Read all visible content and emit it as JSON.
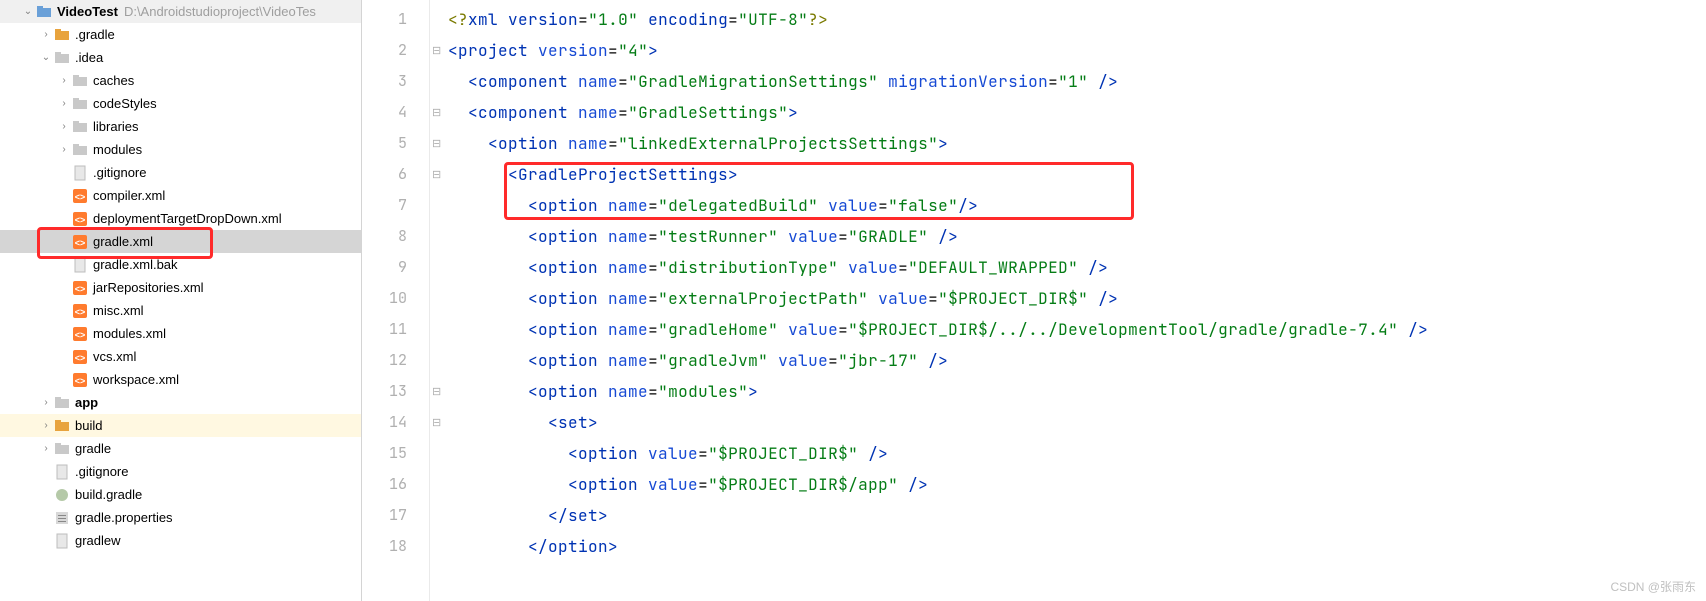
{
  "tree": {
    "root": "VideoTest",
    "root_path": "D:\\Androidstudioproject\\VideoTes",
    "items": [
      {
        "indent": 1,
        "chev": "down",
        "kind": "project",
        "name": "VideoTest",
        "path": "D:\\Androidstudioproject\\VideoTes"
      },
      {
        "indent": 2,
        "chev": "right",
        "kind": "folder-orange",
        "name": ".gradle"
      },
      {
        "indent": 2,
        "chev": "down",
        "kind": "folder-normal",
        "name": ".idea"
      },
      {
        "indent": 3,
        "chev": "right",
        "kind": "folder-leaf",
        "name": "caches"
      },
      {
        "indent": 3,
        "chev": "right",
        "kind": "folder-leaf",
        "name": "codeStyles"
      },
      {
        "indent": 3,
        "chev": "right",
        "kind": "folder-leaf",
        "name": "libraries"
      },
      {
        "indent": 3,
        "chev": "right",
        "kind": "folder-leaf",
        "name": "modules"
      },
      {
        "indent": 3,
        "chev": "none",
        "kind": "file-generic",
        "name": ".gitignore"
      },
      {
        "indent": 3,
        "chev": "none",
        "kind": "file-xml",
        "name": "compiler.xml"
      },
      {
        "indent": 3,
        "chev": "none",
        "kind": "file-xml",
        "name": "deploymentTargetDropDown.xml"
      },
      {
        "indent": 3,
        "chev": "none",
        "kind": "file-xml",
        "name": "gradle.xml",
        "selected": true
      },
      {
        "indent": 3,
        "chev": "none",
        "kind": "file-generic",
        "name": "gradle.xml.bak"
      },
      {
        "indent": 3,
        "chev": "none",
        "kind": "file-xml",
        "name": "jarRepositories.xml"
      },
      {
        "indent": 3,
        "chev": "none",
        "kind": "file-xml",
        "name": "misc.xml"
      },
      {
        "indent": 3,
        "chev": "none",
        "kind": "file-xml",
        "name": "modules.xml"
      },
      {
        "indent": 3,
        "chev": "none",
        "kind": "file-xml",
        "name": "vcs.xml"
      },
      {
        "indent": 3,
        "chev": "none",
        "kind": "file-xml",
        "name": "workspace.xml"
      },
      {
        "indent": 2,
        "chev": "right",
        "kind": "folder-normal",
        "name": "app",
        "bold": true
      },
      {
        "indent": 2,
        "chev": "right",
        "kind": "folder-orange",
        "name": "build",
        "highlight": true
      },
      {
        "indent": 2,
        "chev": "right",
        "kind": "folder-normal",
        "name": "gradle"
      },
      {
        "indent": 2,
        "chev": "none",
        "kind": "file-generic",
        "name": ".gitignore"
      },
      {
        "indent": 2,
        "chev": "none",
        "kind": "file-gradle",
        "name": "build.gradle"
      },
      {
        "indent": 2,
        "chev": "none",
        "kind": "file-properties",
        "name": "gradle.properties"
      },
      {
        "indent": 2,
        "chev": "none",
        "kind": "file-generic",
        "name": "gradlew"
      }
    ]
  },
  "editor": {
    "lines": [
      {
        "n": 1,
        "fold": "",
        "segs": [
          [
            "<?",
            "pi"
          ],
          [
            "xml",
            "pik"
          ],
          [
            " ",
            "punc"
          ],
          [
            "version",
            "pik"
          ],
          [
            "=",
            "punc"
          ],
          [
            "\"1.0\"",
            "pistr"
          ],
          [
            " ",
            "punc"
          ],
          [
            "encoding",
            "pik"
          ],
          [
            "=",
            "punc"
          ],
          [
            "\"UTF-8\"",
            "pistr"
          ],
          [
            "?>",
            "pi"
          ]
        ]
      },
      {
        "n": 2,
        "fold": "-",
        "segs": [
          [
            "<",
            "tag"
          ],
          [
            "project ",
            "tag"
          ],
          [
            "version",
            "attr"
          ],
          [
            "=",
            "punc"
          ],
          [
            "\"4\"",
            "str"
          ],
          [
            ">",
            "tag"
          ]
        ]
      },
      {
        "n": 3,
        "fold": "",
        "segs": [
          [
            "  ",
            "punc"
          ],
          [
            "<",
            "tag"
          ],
          [
            "component ",
            "tag"
          ],
          [
            "name",
            "attr"
          ],
          [
            "=",
            "punc"
          ],
          [
            "\"GradleMigrationSettings\"",
            "str"
          ],
          [
            " ",
            "punc"
          ],
          [
            "migrationVersion",
            "attr"
          ],
          [
            "=",
            "punc"
          ],
          [
            "\"1\"",
            "str"
          ],
          [
            " />",
            "tag"
          ]
        ]
      },
      {
        "n": 4,
        "fold": "-",
        "segs": [
          [
            "  ",
            "punc"
          ],
          [
            "<",
            "tag"
          ],
          [
            "component ",
            "tag"
          ],
          [
            "name",
            "attr"
          ],
          [
            "=",
            "punc"
          ],
          [
            "\"GradleSettings\"",
            "str"
          ],
          [
            ">",
            "tag"
          ]
        ]
      },
      {
        "n": 5,
        "fold": "-",
        "segs": [
          [
            "    ",
            "punc"
          ],
          [
            "<",
            "tag"
          ],
          [
            "option ",
            "tag"
          ],
          [
            "name",
            "attr"
          ],
          [
            "=",
            "punc"
          ],
          [
            "\"linkedExternalProjectsSettings\"",
            "str"
          ],
          [
            ">",
            "tag"
          ]
        ]
      },
      {
        "n": 6,
        "fold": "-",
        "segs": [
          [
            "      ",
            "punc"
          ],
          [
            "<",
            "tag"
          ],
          [
            "GradleProjectSettings",
            "tag"
          ],
          [
            ">",
            "tag"
          ]
        ]
      },
      {
        "n": 7,
        "fold": "",
        "segs": [
          [
            "        ",
            "punc"
          ],
          [
            "<",
            "tag"
          ],
          [
            "option ",
            "tag"
          ],
          [
            "name",
            "attr"
          ],
          [
            "=",
            "punc"
          ],
          [
            "\"delegatedBuild\"",
            "str"
          ],
          [
            " ",
            "punc"
          ],
          [
            "value",
            "attr"
          ],
          [
            "=",
            "punc"
          ],
          [
            "\"false\"",
            "str"
          ],
          [
            "/>",
            "tag"
          ]
        ]
      },
      {
        "n": 8,
        "fold": "",
        "segs": [
          [
            "        ",
            "punc"
          ],
          [
            "<",
            "tag"
          ],
          [
            "option ",
            "tag"
          ],
          [
            "name",
            "attr"
          ],
          [
            "=",
            "punc"
          ],
          [
            "\"testRunner\"",
            "str"
          ],
          [
            " ",
            "punc"
          ],
          [
            "value",
            "attr"
          ],
          [
            "=",
            "punc"
          ],
          [
            "\"GRADLE\"",
            "str"
          ],
          [
            " />",
            "tag"
          ]
        ]
      },
      {
        "n": 9,
        "fold": "",
        "segs": [
          [
            "        ",
            "punc"
          ],
          [
            "<",
            "tag"
          ],
          [
            "option ",
            "tag"
          ],
          [
            "name",
            "attr"
          ],
          [
            "=",
            "punc"
          ],
          [
            "\"distributionType\"",
            "str"
          ],
          [
            " ",
            "punc"
          ],
          [
            "value",
            "attr"
          ],
          [
            "=",
            "punc"
          ],
          [
            "\"DEFAULT_WRAPPED\"",
            "str"
          ],
          [
            " />",
            "tag"
          ]
        ]
      },
      {
        "n": 10,
        "fold": "",
        "segs": [
          [
            "        ",
            "punc"
          ],
          [
            "<",
            "tag"
          ],
          [
            "option ",
            "tag"
          ],
          [
            "name",
            "attr"
          ],
          [
            "=",
            "punc"
          ],
          [
            "\"externalProjectPath\"",
            "str"
          ],
          [
            " ",
            "punc"
          ],
          [
            "value",
            "attr"
          ],
          [
            "=",
            "punc"
          ],
          [
            "\"$PROJECT_DIR$\"",
            "str"
          ],
          [
            " />",
            "tag"
          ]
        ]
      },
      {
        "n": 11,
        "fold": "",
        "segs": [
          [
            "        ",
            "punc"
          ],
          [
            "<",
            "tag"
          ],
          [
            "option ",
            "tag"
          ],
          [
            "name",
            "attr"
          ],
          [
            "=",
            "punc"
          ],
          [
            "\"gradleHome\"",
            "str"
          ],
          [
            " ",
            "punc"
          ],
          [
            "value",
            "attr"
          ],
          [
            "=",
            "punc"
          ],
          [
            "\"$PROJECT_DIR$/../../DevelopmentTool/gradle/gradle-7.4\"",
            "str"
          ],
          [
            " />",
            "tag"
          ]
        ]
      },
      {
        "n": 12,
        "fold": "",
        "segs": [
          [
            "        ",
            "punc"
          ],
          [
            "<",
            "tag"
          ],
          [
            "option ",
            "tag"
          ],
          [
            "name",
            "attr"
          ],
          [
            "=",
            "punc"
          ],
          [
            "\"gradleJvm\"",
            "str"
          ],
          [
            " ",
            "punc"
          ],
          [
            "value",
            "attr"
          ],
          [
            "=",
            "punc"
          ],
          [
            "\"jbr-17\"",
            "str"
          ],
          [
            " />",
            "tag"
          ]
        ]
      },
      {
        "n": 13,
        "fold": "-",
        "segs": [
          [
            "        ",
            "punc"
          ],
          [
            "<",
            "tag"
          ],
          [
            "option ",
            "tag"
          ],
          [
            "name",
            "attr"
          ],
          [
            "=",
            "punc"
          ],
          [
            "\"modules\"",
            "str"
          ],
          [
            ">",
            "tag"
          ]
        ]
      },
      {
        "n": 14,
        "fold": "-",
        "segs": [
          [
            "          ",
            "punc"
          ],
          [
            "<",
            "tag"
          ],
          [
            "set",
            "tag"
          ],
          [
            ">",
            "tag"
          ]
        ]
      },
      {
        "n": 15,
        "fold": "",
        "segs": [
          [
            "            ",
            "punc"
          ],
          [
            "<",
            "tag"
          ],
          [
            "option ",
            "tag"
          ],
          [
            "value",
            "attr"
          ],
          [
            "=",
            "punc"
          ],
          [
            "\"$PROJECT_DIR$\"",
            "str"
          ],
          [
            " />",
            "tag"
          ]
        ]
      },
      {
        "n": 16,
        "fold": "",
        "segs": [
          [
            "            ",
            "punc"
          ],
          [
            "<",
            "tag"
          ],
          [
            "option ",
            "tag"
          ],
          [
            "value",
            "attr"
          ],
          [
            "=",
            "punc"
          ],
          [
            "\"$PROJECT_DIR$/app\"",
            "str"
          ],
          [
            " />",
            "tag"
          ]
        ]
      },
      {
        "n": 17,
        "fold": "",
        "segs": [
          [
            "          ",
            "punc"
          ],
          [
            "</",
            "tag"
          ],
          [
            "set",
            "tag"
          ],
          [
            ">",
            "tag"
          ]
        ]
      },
      {
        "n": 18,
        "fold": "",
        "segs": [
          [
            "        ",
            "punc"
          ],
          [
            "</",
            "tag"
          ],
          [
            "option",
            "tag"
          ],
          [
            ">",
            "tag"
          ]
        ]
      }
    ]
  },
  "watermark": "CSDN @张雨东"
}
